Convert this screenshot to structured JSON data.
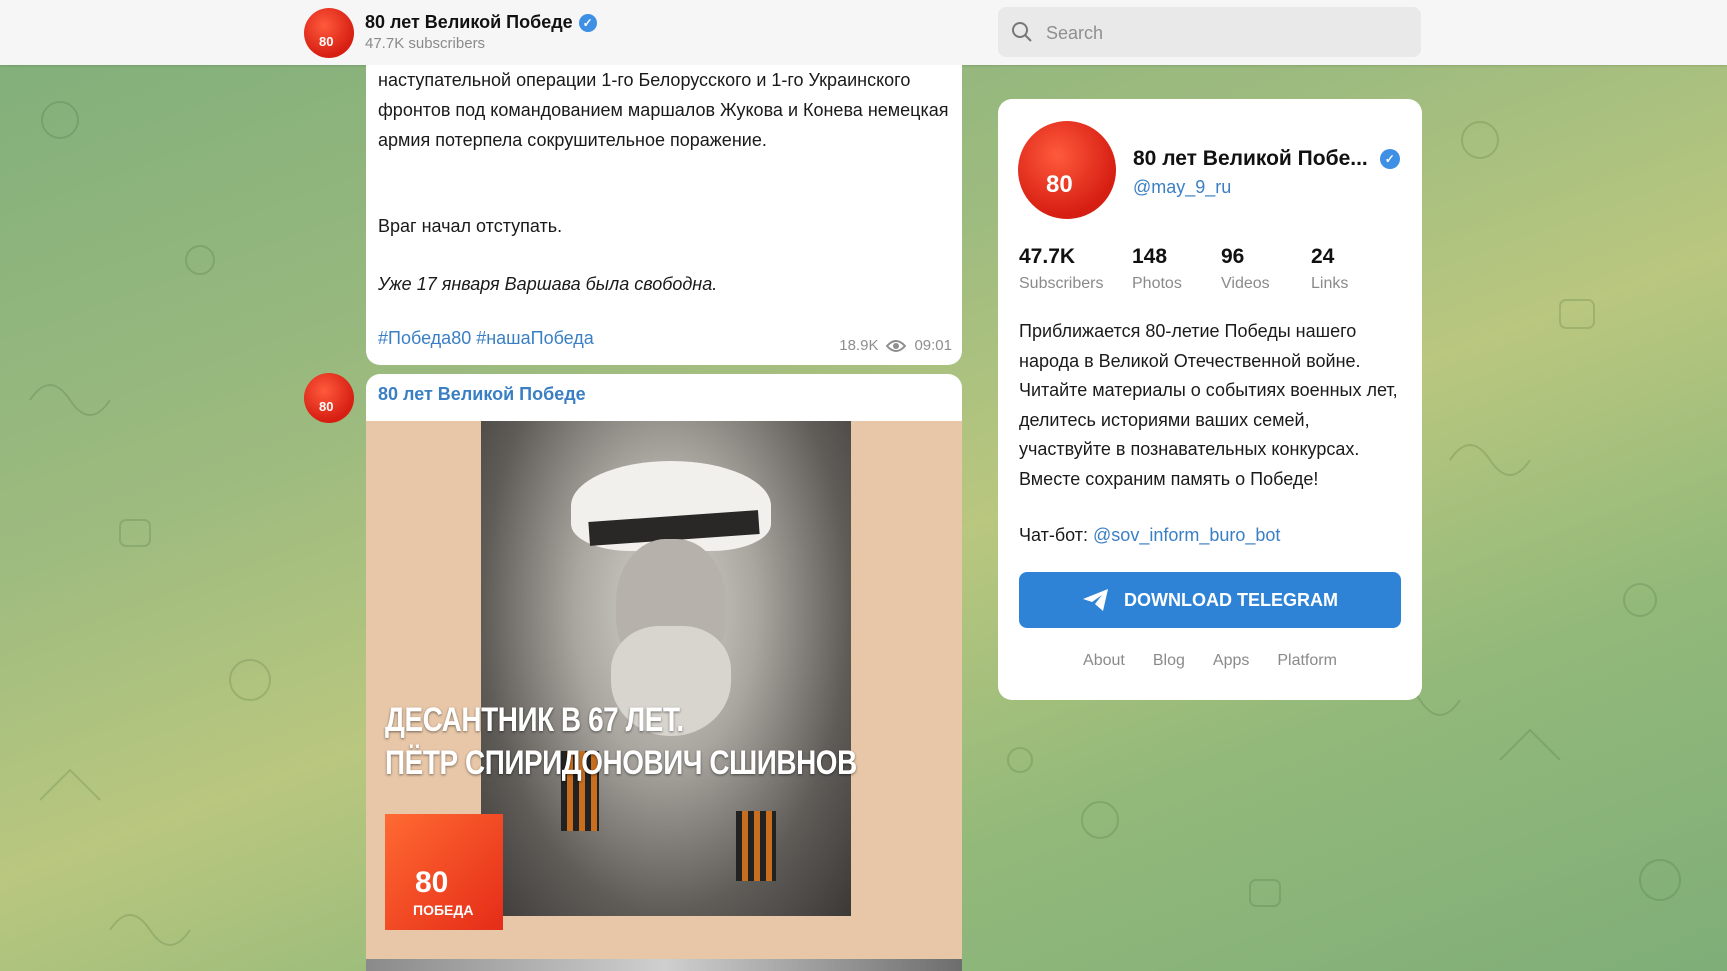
{
  "header": {
    "channel_title": "80 лет Великой Победе",
    "subscribers": "47.7K subscribers",
    "search_placeholder": "Search"
  },
  "post1": {
    "paragraph1": "наступательной операции 1-го Белорусского и 1-го Украинского фронтов под командованием маршалов Жукова и Конева немецкая армия потерпела сокрушительное поражение.",
    "paragraph2": "Враг начал отступать.",
    "paragraph3": "Уже 17 января Варшава была свободна.",
    "hashtags": "#Победа80 #нашаПобеда",
    "views": "18.9K",
    "time": "09:01"
  },
  "post2": {
    "author": "80 лет Великой Победе",
    "image_caption_line1": "ДЕСАНТНИК В 67 ЛЕТ.",
    "image_caption_line2": "ПЁТР СПИРИДОНОВИЧ СШИВНОВ",
    "logo_number": "80",
    "logo_label": "ПОБЕДА"
  },
  "channel_card": {
    "name": "80 лет Великой Побе...",
    "handle": "@may_9_ru",
    "stats": [
      {
        "value": "47.7K",
        "label": "Subscribers"
      },
      {
        "value": "148",
        "label": "Photos"
      },
      {
        "value": "96",
        "label": "Videos"
      },
      {
        "value": "24",
        "label": "Links"
      }
    ],
    "description": "Приближается 80-летие Победы нашего народа в Великой Отечественной войне. Читайте материалы о событиях военных лет, делитесь историями ваших семей, участвуйте в познавательных конкурсах. Вместе сохраним память о Победе!",
    "chatbot_label": "Чат-бот: ",
    "chatbot_link": "@sov_inform_buro_bot",
    "download_button": "DOWNLOAD TELEGRAM",
    "footer_links": [
      "About",
      "Blog",
      "Apps",
      "Platform"
    ]
  },
  "colors": {
    "accent": "#2f83d6",
    "link": "#3a7fc4",
    "avatar_red": "#e52c18",
    "verified": "#3d90e3"
  },
  "icons": [
    "search-icon",
    "verified-icon",
    "eye-icon",
    "telegram-plane-icon"
  ]
}
